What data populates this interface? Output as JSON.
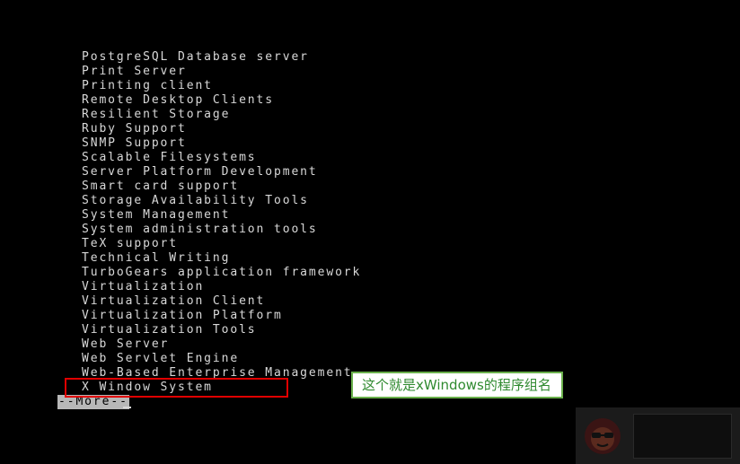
{
  "terminal": {
    "groups": [
      "PostgreSQL Database server",
      "Print Server",
      "Printing client",
      "Remote Desktop Clients",
      "Resilient Storage",
      "Ruby Support",
      "SNMP Support",
      "Scalable Filesystems",
      "Server Platform Development",
      "Smart card support",
      "Storage Availability Tools",
      "System Management",
      "System administration tools",
      "TeX support",
      "Technical Writing",
      "TurboGears application framework",
      "Virtualization",
      "Virtualization Client",
      "Virtualization Platform",
      "Virtualization Tools",
      "Web Server",
      "Web Servlet Engine",
      "Web-Based Enterprise Management",
      "X Window System"
    ],
    "more_prompt": "--More--"
  },
  "annotation": {
    "text": "这个就是xWindows的程序组名"
  },
  "colors": {
    "background": "#000000",
    "text": "#d8d8d8",
    "highlight_border": "#e00000",
    "annotation_border": "#6ab04c",
    "annotation_text": "#2f8a2f"
  }
}
